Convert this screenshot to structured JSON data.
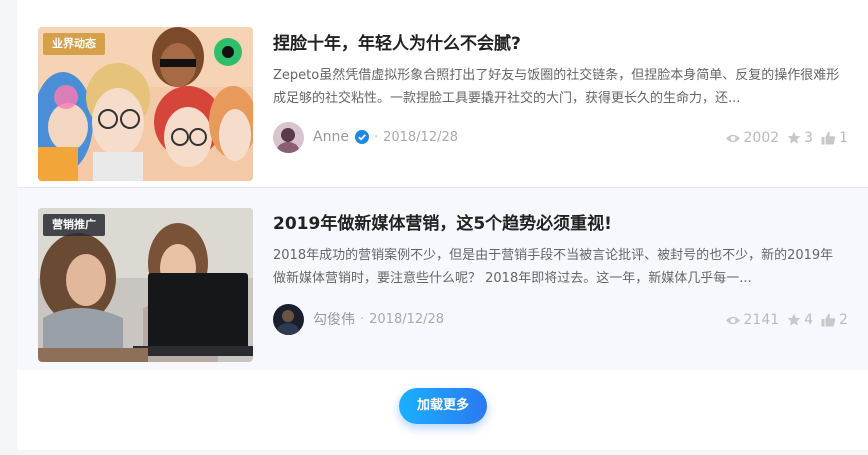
{
  "articles": [
    {
      "tag": "业界动态",
      "title": "捏脸十年，年轻人为什么不会腻?",
      "excerpt": "Zepeto虽然凭借虚拟形象合照打出了好友与饭圈的社交链条，但捏脸本身简单、反复的操作很难形成足够的社交粘性。一款捏脸工具要撬开社交的大门，获得更长久的生命力，还...",
      "author": "Anne",
      "date": "2018/12/28",
      "views": "2002",
      "stars": "3",
      "likes": "1"
    },
    {
      "tag": "营销推广",
      "title": "2019年做新媒体营销，这5个趋势必须重视!",
      "excerpt": "2018年成功的营销案例不少，但是由于营销手段不当被言论批评、被封号的也不少，新的2019年做新媒体营销时，要注意些什么呢？ 2018年即将过去。这一年，新媒体几乎每一...",
      "author": "勾俊伟",
      "date": "2018/12/28",
      "views": "2141",
      "stars": "4",
      "likes": "2"
    }
  ],
  "load_more_label": "加载更多",
  "separator": "·",
  "colors": {
    "tag_gold": "#d6a04a",
    "tag_dark": "#282c34",
    "button_gradient_start": "#1ab0ff",
    "button_gradient_end": "#2a7af0",
    "verified_badge": "#1e88e5"
  },
  "icons": {
    "views": "eye-icon",
    "stars": "star-icon",
    "likes": "thumbs-up-icon",
    "verified": "verified-badge-icon"
  }
}
